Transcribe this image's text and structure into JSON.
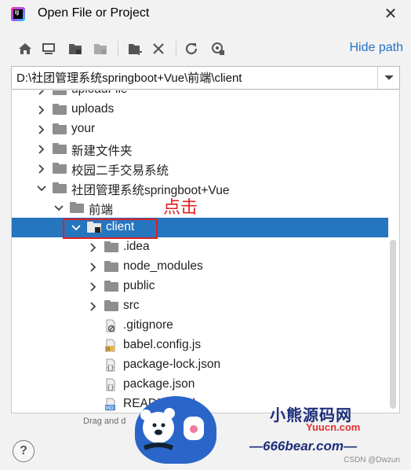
{
  "window": {
    "title": "Open File or Project",
    "close_glyph": "✕",
    "app_icon": "intellij-idea-icon"
  },
  "toolbar": {
    "buttons": [
      "home-icon",
      "desktop-icon",
      "project-folder-icon",
      "module-folder-icon",
      "new-folder-icon",
      "delete-icon",
      "refresh-icon",
      "show-hidden-icon"
    ],
    "hide_path_label": "Hide path"
  },
  "path": {
    "value": "D:\\社团管理系统springboot+Vue\\前端\\client"
  },
  "tree": {
    "items": [
      {
        "label": "uploadFile",
        "kind": "folder",
        "level": 0,
        "expanded": false
      },
      {
        "label": "uploads",
        "kind": "folder",
        "level": 0,
        "expanded": false
      },
      {
        "label": "your",
        "kind": "folder",
        "level": 0,
        "expanded": false
      },
      {
        "label": "新建文件夹",
        "kind": "folder",
        "level": 0,
        "expanded": false
      },
      {
        "label": "校园二手交易系统",
        "kind": "folder",
        "level": 0,
        "expanded": false
      },
      {
        "label": "社团管理系统springboot+Vue",
        "kind": "folder",
        "level": 0,
        "expanded": true
      },
      {
        "label": "前端",
        "kind": "folder",
        "level": 1,
        "expanded": true
      },
      {
        "label": "client",
        "kind": "module-folder",
        "level": 2,
        "expanded": true,
        "selected": true
      },
      {
        "label": ".idea",
        "kind": "folder",
        "level": 3,
        "expanded": false
      },
      {
        "label": "node_modules",
        "kind": "folder",
        "level": 3,
        "expanded": false
      },
      {
        "label": "public",
        "kind": "folder",
        "level": 3,
        "expanded": false
      },
      {
        "label": "src",
        "kind": "folder",
        "level": 3,
        "expanded": false
      },
      {
        "label": ".gitignore",
        "kind": "ignore-file",
        "level": 3
      },
      {
        "label": "babel.config.js",
        "kind": "js-file",
        "level": 3
      },
      {
        "label": "package-lock.json",
        "kind": "json-file",
        "level": 3
      },
      {
        "label": "package.json",
        "kind": "json-file",
        "level": 3
      },
      {
        "label": "README.md",
        "kind": "md-file",
        "level": 3
      }
    ]
  },
  "footer": {
    "drag_hint": "Drag and d",
    "help_label": "?"
  },
  "annotation": {
    "text": "点击",
    "color": "#e02020"
  },
  "watermark": {
    "title": "小熊源码网",
    "site": "Yuucn.com",
    "url": "—666bear.com—",
    "csdn": "CSDN @Dwzun"
  },
  "colors": {
    "selection": "#2675bf",
    "link": "#2472c8",
    "folder": "#8e8e8e"
  }
}
